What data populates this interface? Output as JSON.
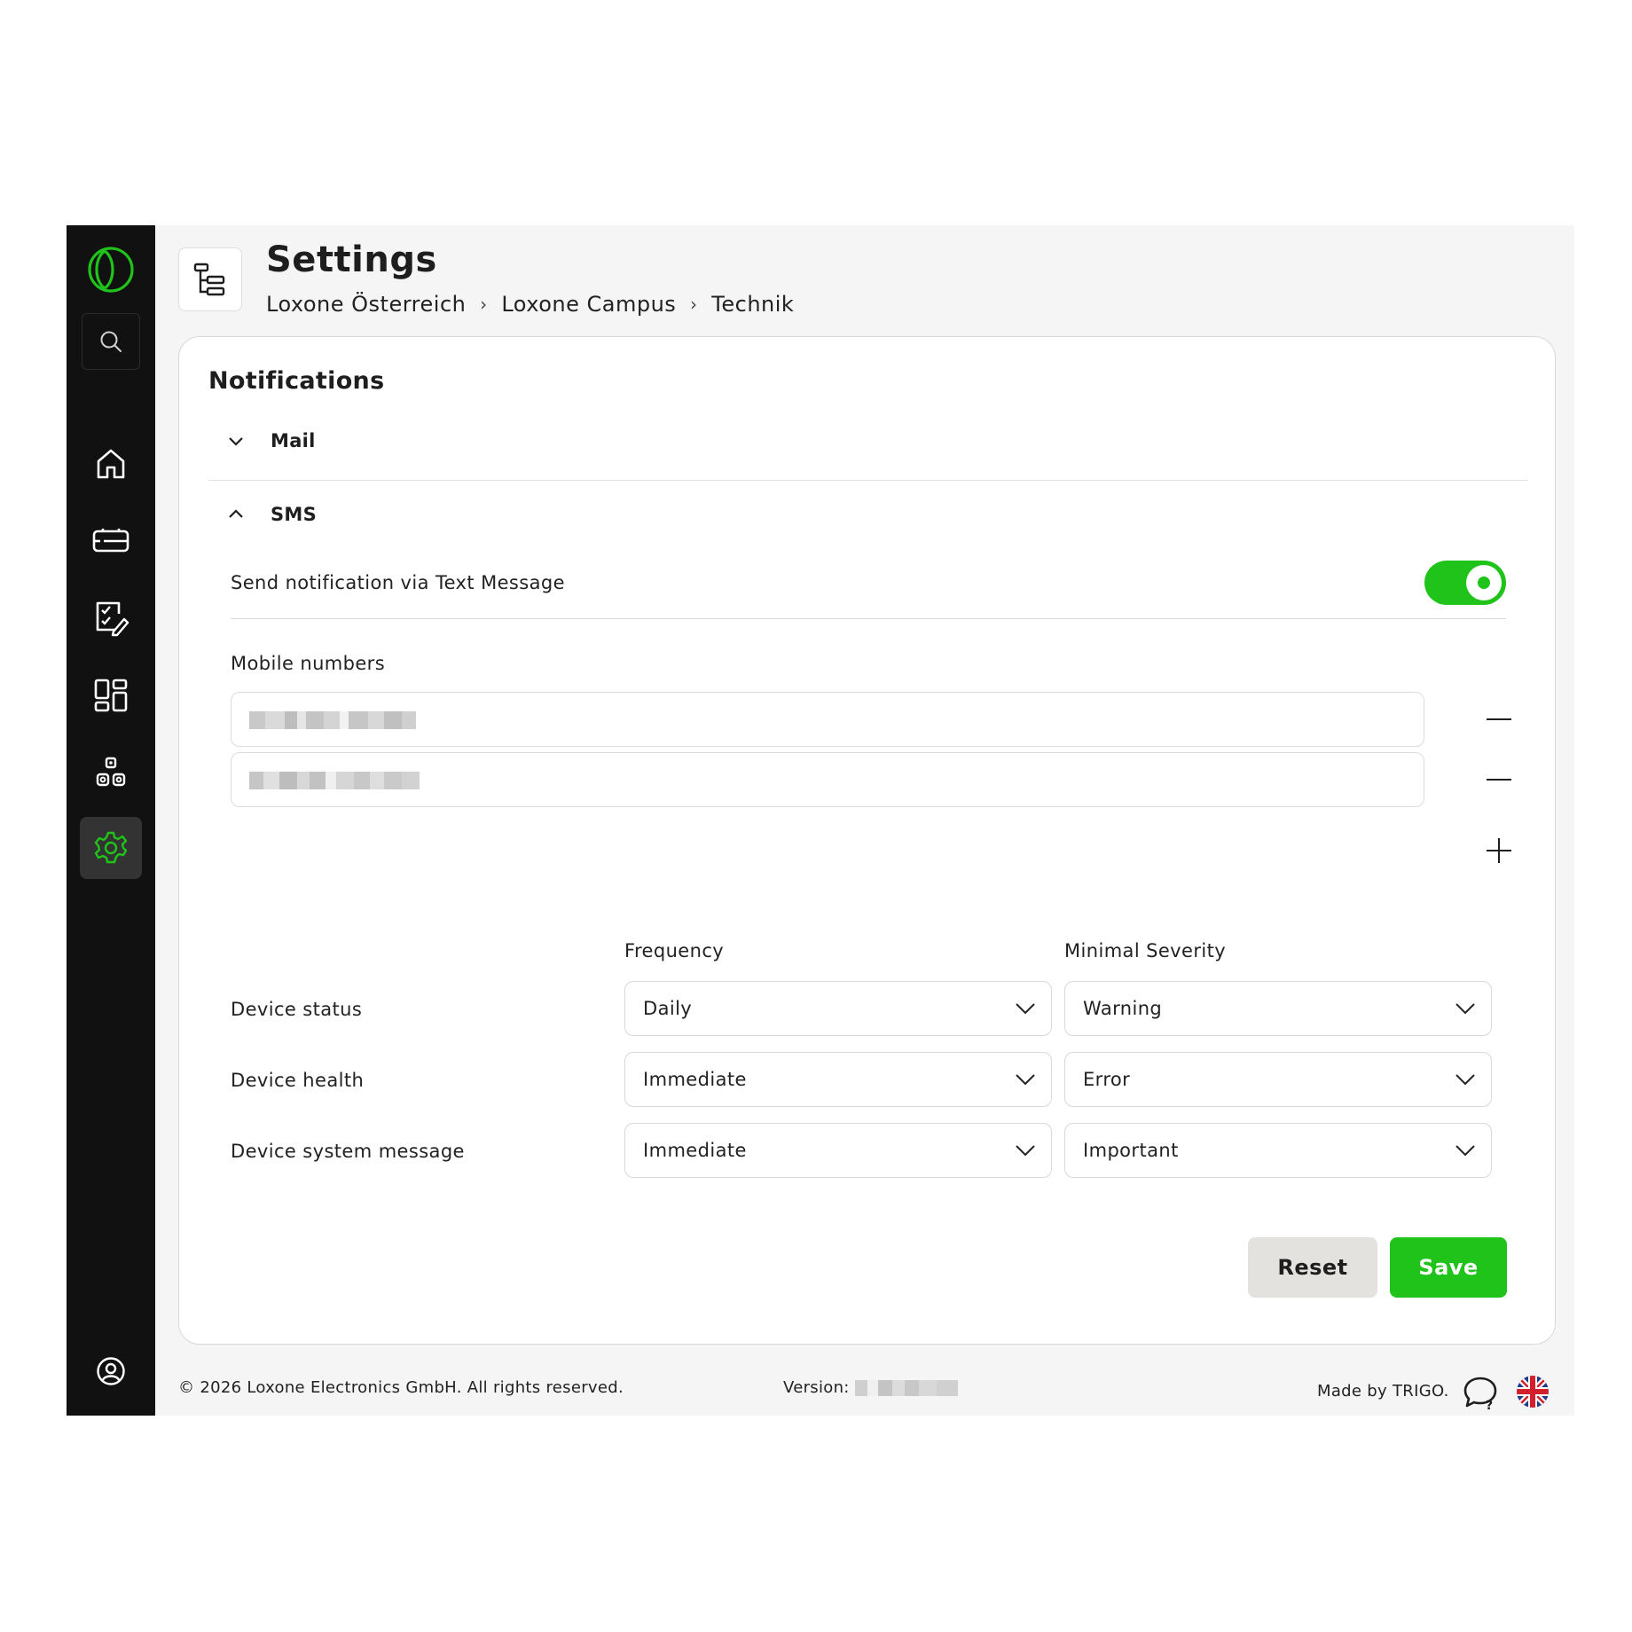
{
  "sidebar": {
    "items": [
      {
        "name": "logo-icon"
      },
      {
        "name": "search-icon"
      },
      {
        "name": "home-icon"
      },
      {
        "name": "devices-icon"
      },
      {
        "name": "tasks-icon"
      },
      {
        "name": "dashboard-icon"
      },
      {
        "name": "components-icon"
      },
      {
        "name": "settings-icon",
        "active": true
      },
      {
        "name": "user-icon"
      }
    ],
    "accent": "#1fc31a"
  },
  "header": {
    "icon": "hierarchy-tree-icon",
    "title": "Settings",
    "breadcrumb": [
      "Loxone Österreich",
      "Loxone Campus",
      "Technik"
    ],
    "breadcrumb_separator": "›"
  },
  "card": {
    "title": "Notifications",
    "sections": [
      {
        "label": "Mail",
        "expanded": false
      },
      {
        "label": "SMS",
        "expanded": true
      }
    ],
    "sms": {
      "toggle_label": "Send notification via Text Message",
      "toggle_on": true,
      "mobile_label": "Mobile numbers",
      "numbers_redacted": true
    },
    "table": {
      "col_frequency": "Frequency",
      "col_severity": "Minimal Severity",
      "rows": [
        {
          "label": "Device status",
          "frequency": "Daily",
          "severity": "Warning"
        },
        {
          "label": "Device health",
          "frequency": "Immediate",
          "severity": "Error"
        },
        {
          "label": "Device system message",
          "frequency": "Immediate",
          "severity": "Important"
        }
      ]
    },
    "reset_label": "Reset",
    "save_label": "Save"
  },
  "footer": {
    "copyright": "© 2026 Loxone Electronics GmbH. All rights reserved.",
    "version_label": "Version:",
    "made_by": "Made by TRIGO."
  },
  "colors": {
    "accent": "#1fc31a",
    "sidebar_bg": "#111111",
    "page_bg": "#f5f5f5"
  }
}
